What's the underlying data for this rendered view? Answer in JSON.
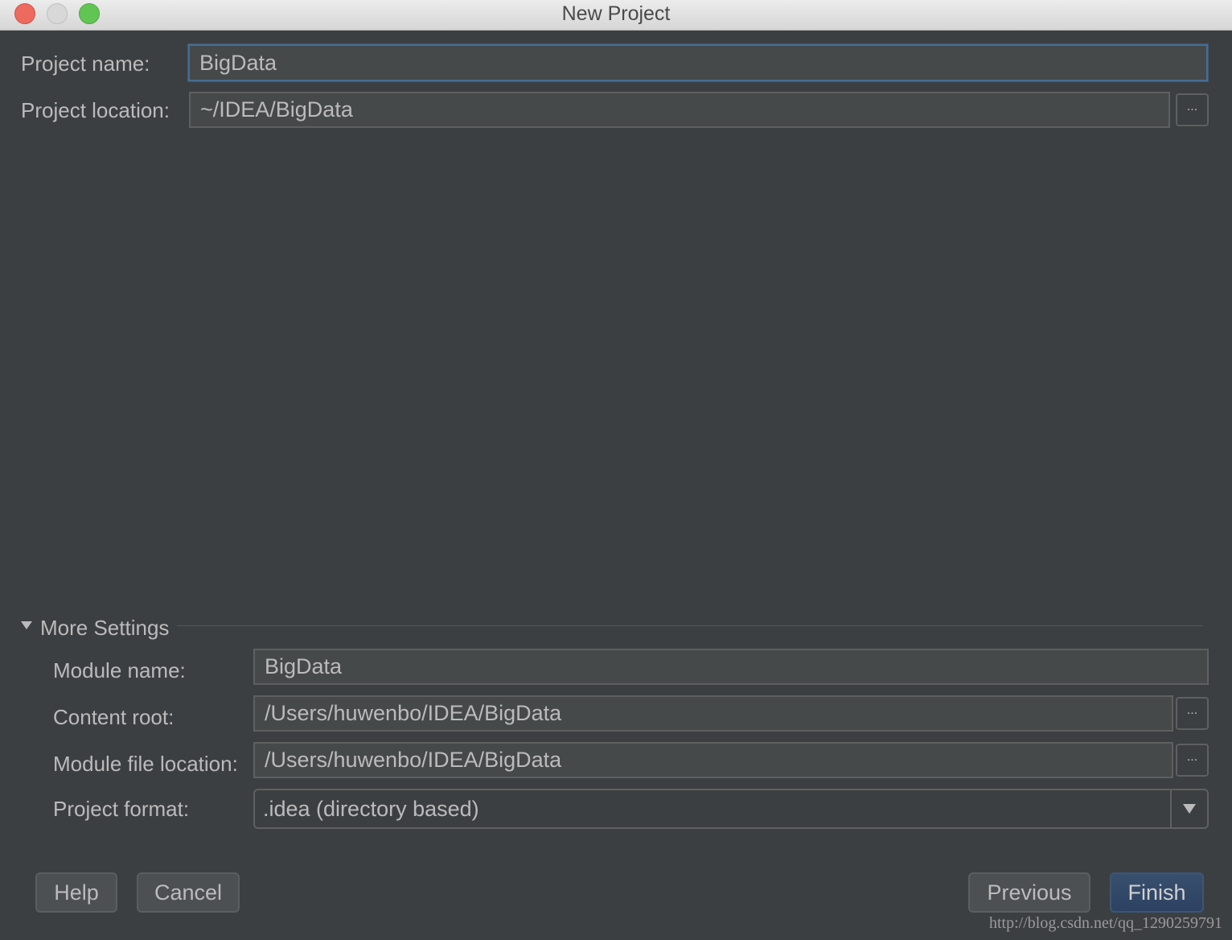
{
  "window": {
    "title": "New Project",
    "controls": {
      "close_color": "#ed6a5e",
      "minimize_color": "#d8d8d8",
      "zoom_color": "#61c554"
    }
  },
  "project": {
    "name_label": "Project name:",
    "name_value": "BigData",
    "location_label": "Project location:",
    "location_value": "~/IDEA/BigData",
    "browse_label": "..."
  },
  "more_settings": {
    "title": "More Settings",
    "expanded": true,
    "module_name_label": "Module name:",
    "module_name_value": "BigData",
    "content_root_label": "Content root:",
    "content_root_value": "/Users/huwenbo/IDEA/BigData",
    "module_file_label": "Module file location:",
    "module_file_value": "/Users/huwenbo/IDEA/BigData",
    "format_label": "Project format:",
    "format_value": ".idea (directory based)",
    "browse_label": "..."
  },
  "buttons": {
    "help": "Help",
    "cancel": "Cancel",
    "previous": "Previous",
    "finish": "Finish"
  },
  "watermark": "http://blog.csdn.net/qq_1290259791",
  "colors": {
    "background": "#3c3f41",
    "field": "#45494a",
    "focus_border": "#466d94",
    "primary_button": "#34496a"
  }
}
